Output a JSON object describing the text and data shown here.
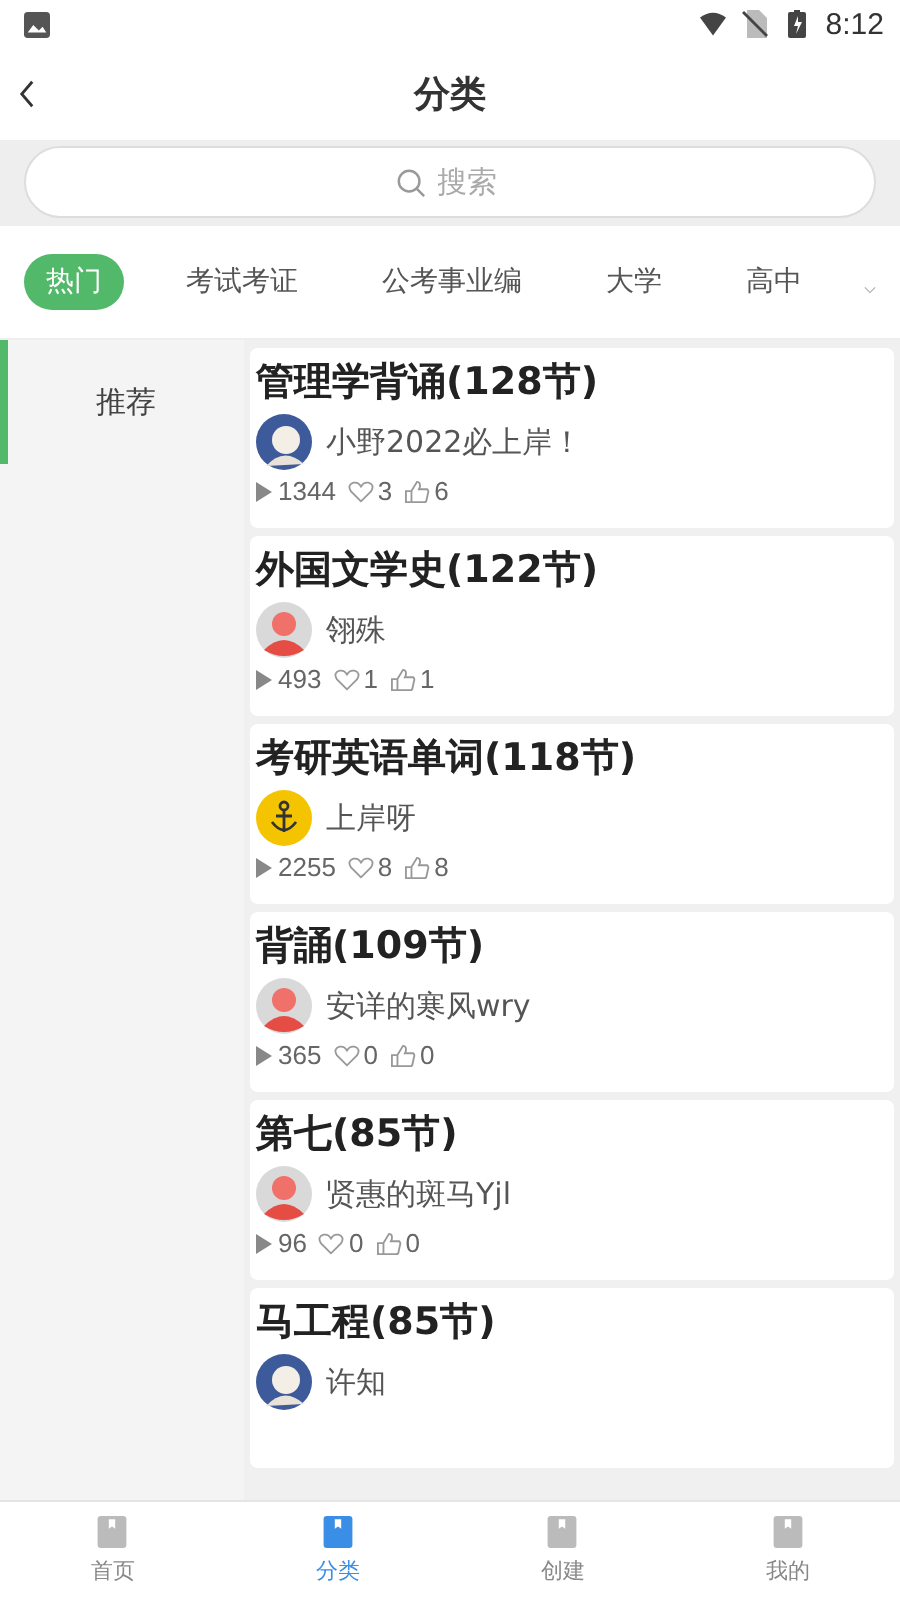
{
  "status_bar": {
    "time": "8:12"
  },
  "header": {
    "title": "分类"
  },
  "search": {
    "placeholder": "搜索"
  },
  "tabs": [
    {
      "label": "热门",
      "selected": true
    },
    {
      "label": "考试考证",
      "selected": false
    },
    {
      "label": "公考事业编",
      "selected": false
    },
    {
      "label": "大学",
      "selected": false
    },
    {
      "label": "高中",
      "selected": false
    }
  ],
  "sidebar": {
    "items": [
      {
        "label": "推荐",
        "selected": true
      }
    ]
  },
  "courses": [
    {
      "title": "管理学背诵(128节)",
      "author": "小野2022必上岸！",
      "kind": "picture",
      "plays": "1344",
      "favorites": "3",
      "likes": "6"
    },
    {
      "title": "外国文学史(122节)",
      "author": "翎殊",
      "kind": "default",
      "plays": "493",
      "favorites": "1",
      "likes": "1"
    },
    {
      "title": "考研英语单词(118节)",
      "author": "上岸呀",
      "kind": "anchor",
      "plays": "2255",
      "favorites": "8",
      "likes": "8"
    },
    {
      "title": "背誦(109节)",
      "author": "安详的寒风wry",
      "kind": "default",
      "plays": "365",
      "favorites": "0",
      "likes": "0"
    },
    {
      "title": "第七(85节)",
      "author": "贤惠的斑马Yjl",
      "kind": "default",
      "plays": "96",
      "favorites": "0",
      "likes": "0"
    },
    {
      "title": "马工程(85节)",
      "author": "许知",
      "kind": "picture"
    }
  ],
  "bottom_nav": [
    {
      "label": "首页",
      "selected": false
    },
    {
      "label": "分类",
      "selected": true
    },
    {
      "label": "创建",
      "selected": false
    },
    {
      "label": "我的",
      "selected": false
    }
  ]
}
